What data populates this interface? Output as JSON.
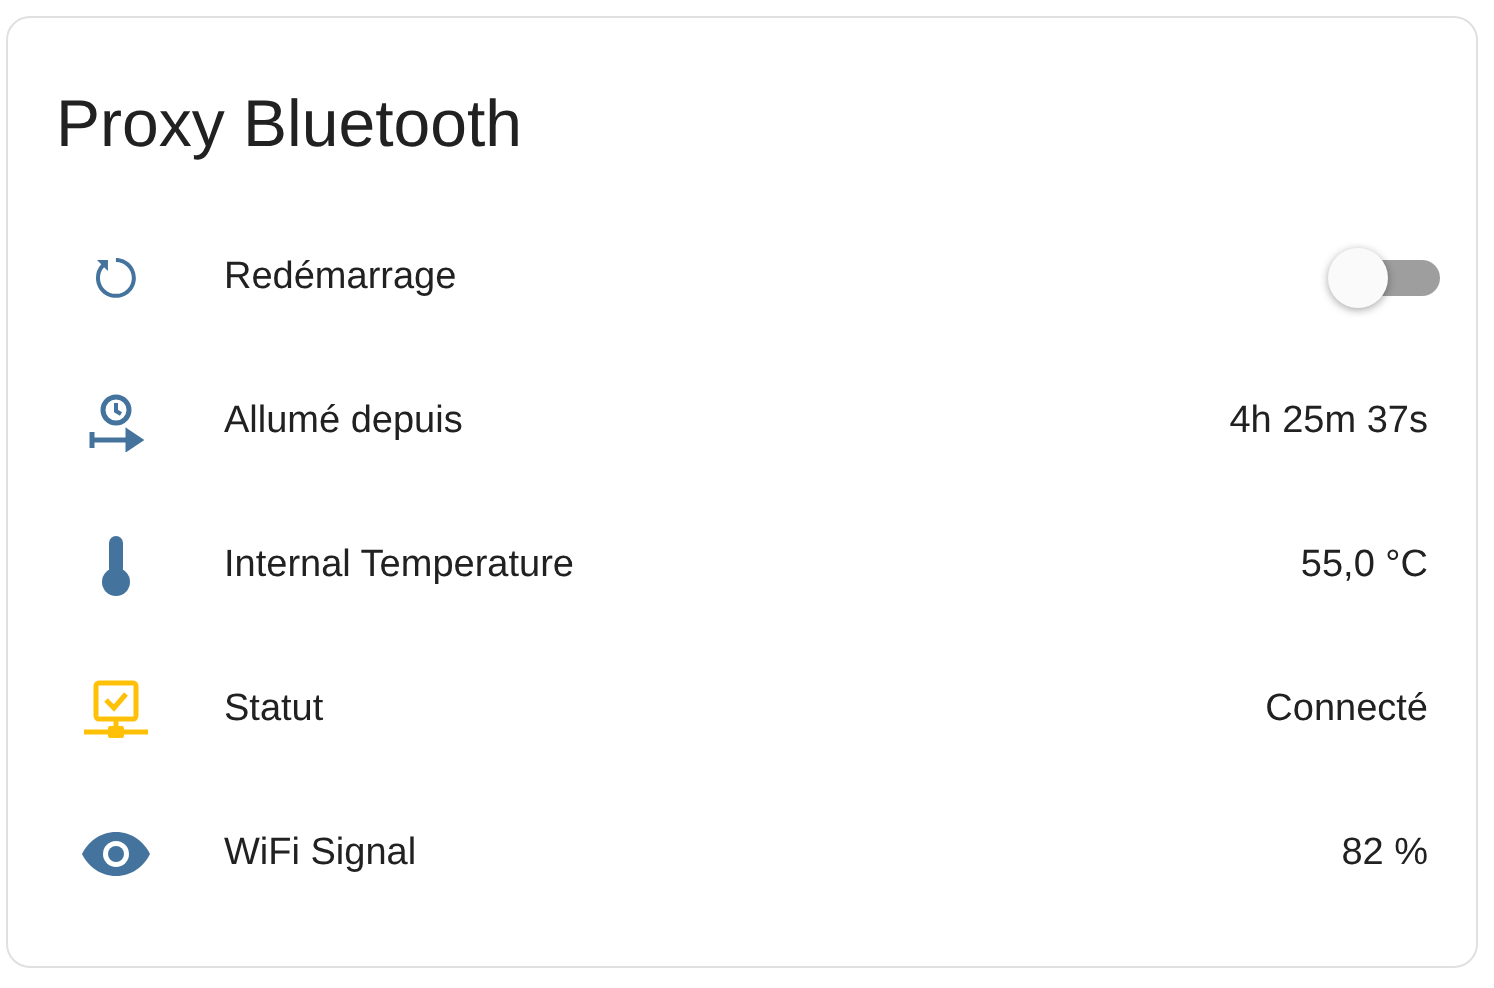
{
  "card": {
    "title": "Proxy Bluetooth"
  },
  "rows": [
    {
      "kind": "switch",
      "label": "Redémarrage",
      "on": false,
      "color": "#44739e"
    },
    {
      "kind": "value",
      "label": "Allumé depuis",
      "value": "4h 25m 37s",
      "color": "#44739e"
    },
    {
      "kind": "value",
      "label": "Internal Temperature",
      "value": "55,0 °C",
      "color": "#44739e"
    },
    {
      "kind": "value",
      "label": "Statut",
      "value": "Connecté",
      "color": "#ffc107"
    },
    {
      "kind": "value",
      "label": "WiFi Signal",
      "value": "82 %",
      "color": "#44739e"
    }
  ]
}
